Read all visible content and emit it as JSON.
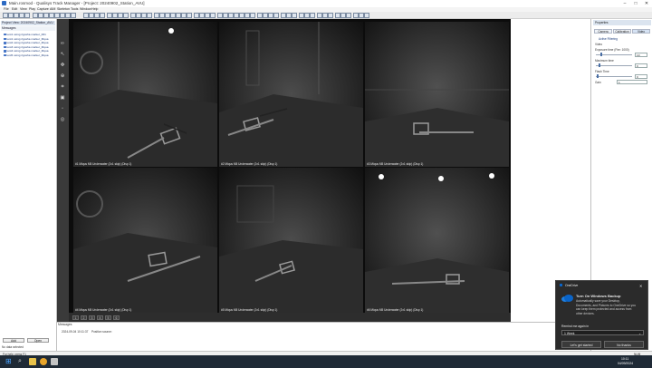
{
  "window": {
    "title": "Main.rosmod - Qualisys Track Manager - [Project: 20240902_Station_AVU]",
    "minimize": "–",
    "maximize": "□",
    "close": "✕"
  },
  "menus": [
    "File",
    "Edit",
    "View",
    "Play",
    "Capture",
    "AIM",
    "Skeleton",
    "Tools",
    "Window",
    "Help"
  ],
  "left_panel": {
    "header": "Project View: 20240902_Station_AVU",
    "subheader": "Messages",
    "files": [
      "test1 using rigosha marker_001",
      "test1 using rigosha marker_Mqua",
      "test2 using rigosha marker_Mqua",
      "test3 using rigosha marker_Mqua",
      "test4 using rigosha marker_Mqua",
      "test5 using rigosha marker_Mqua"
    ],
    "add_button": "Add",
    "open_button": "Open",
    "status": "No data selected"
  },
  "grid": {
    "cells": [
      {
        "label": "#1 Miqus M5 Underwater (2x1 skip) (Disp 1)"
      },
      {
        "label": "#2 Miqus M5 Underwater (2x1 skip) (Disp 1)"
      },
      {
        "label": "#3 Miqus M5 Underwater (2x1 skip) (Disp 1)"
      },
      {
        "label": "#4 Miqus M5 Underwater (2x1 skip) (Disp 1)"
      },
      {
        "label": "#5 Miqus M5 Underwater (2x1 skip) (Disp 1)"
      },
      {
        "label": "#6 Miqus M5 Underwater (2x1 skip) (Disp 1)"
      }
    ]
  },
  "pages": [
    "1",
    "2",
    "3",
    "4",
    "5",
    "6"
  ],
  "messages": {
    "header": "Messages",
    "row_time": "2024-09-04 10:11:37",
    "row_text": "Position source:"
  },
  "right_panel": {
    "title": "Properties",
    "tabs": [
      "Camera",
      "Calibration",
      "Video"
    ],
    "section": "Active Filtering",
    "subsection": "Video",
    "fields": [
      {
        "label": "Exposure time (Fire: 1000)",
        "value": "10"
      },
      {
        "label": "Maximum time",
        "value": "0"
      },
      {
        "label": "Flash Time",
        "value": "0"
      },
      {
        "label": "Gain",
        "value": "1"
      }
    ]
  },
  "statusbar": {
    "left": "For help, press F1",
    "right": "NUM"
  },
  "taskbar": {
    "time": "10:11",
    "date": "04/09/2024"
  },
  "popup": {
    "app": "OneDrive",
    "title": "Turn On Windows Backup",
    "body": "Automatically save your Desktop, Documents, and Pictures to OneDrive so you can keep them protected and access from other devices.",
    "remind_label": "Remind me again in",
    "remind_value": "1 Week",
    "primary": "Let's get started",
    "secondary": "No thanks"
  },
  "colors": {
    "accent": "#0a64c8",
    "video_bg": "#0c0c0c",
    "taskbar": "#1f2a36"
  }
}
